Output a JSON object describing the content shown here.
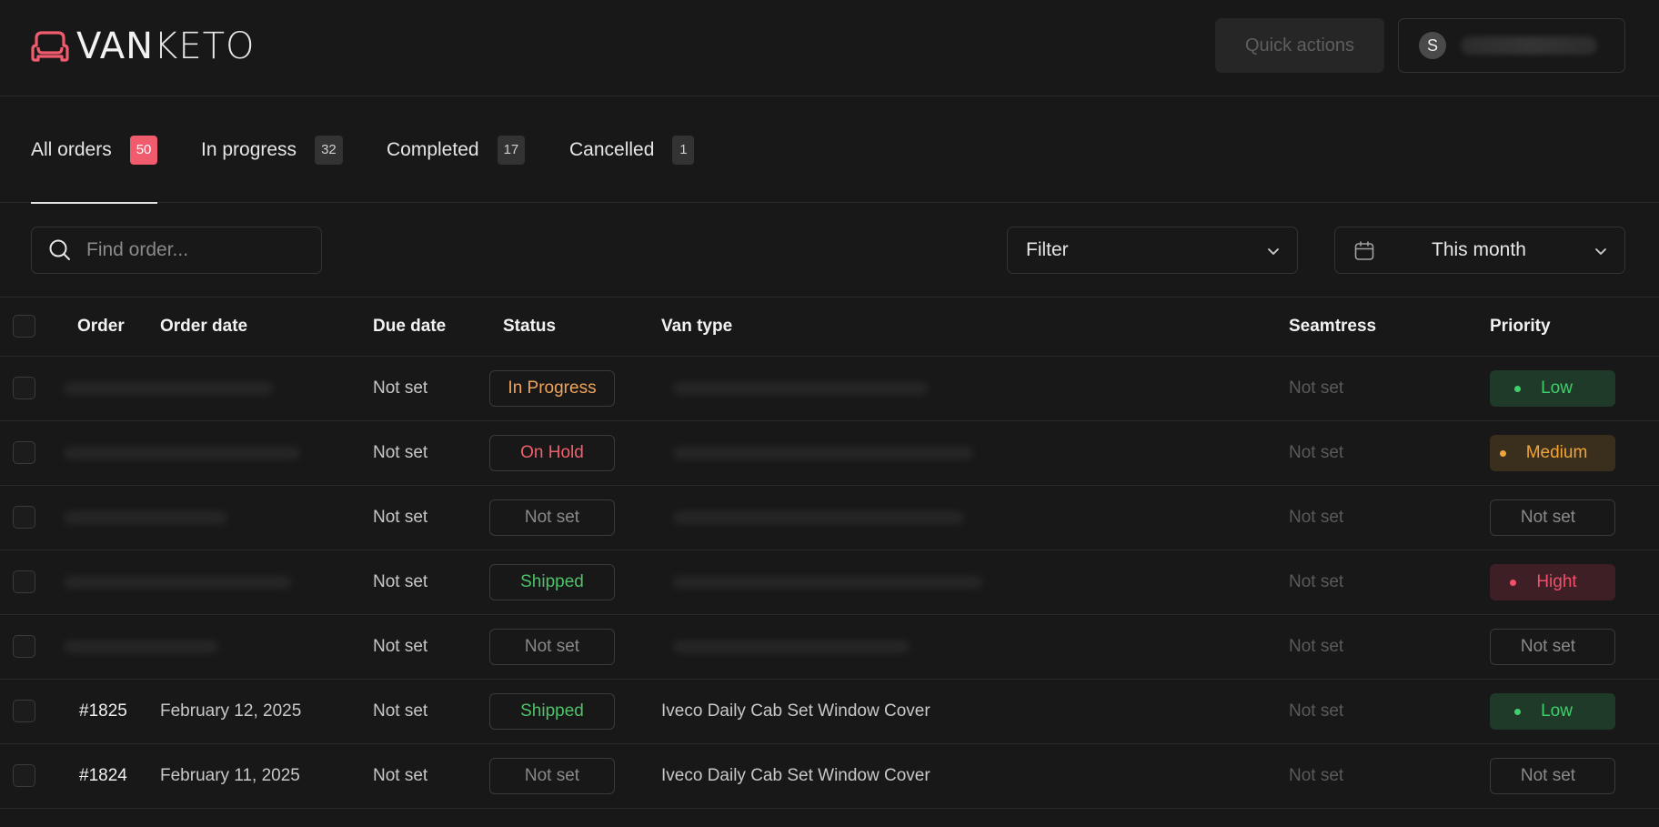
{
  "header": {
    "brand_bold": "VAN",
    "brand_thin": "KETO",
    "quick_actions_label": "Quick actions",
    "user_initial": "S"
  },
  "tabs": [
    {
      "label": "All orders",
      "count": "50",
      "active": true
    },
    {
      "label": "In progress",
      "count": "32",
      "active": false
    },
    {
      "label": "Completed",
      "count": "17",
      "active": false
    },
    {
      "label": "Cancelled",
      "count": "1",
      "active": false
    }
  ],
  "toolbar": {
    "search_placeholder": "Find order...",
    "filter_label": "Filter",
    "date_range_label": "This month"
  },
  "table": {
    "columns": [
      "Order",
      "Order date",
      "Due date",
      "Status",
      "Van type",
      "Seamtress",
      "Priority"
    ],
    "rows": [
      {
        "order": "",
        "order_date": "",
        "due_date": "Not set",
        "status": "In Progress",
        "van_type": "",
        "seamtress": "Not set",
        "priority": "Low"
      },
      {
        "order": "",
        "order_date": "",
        "due_date": "Not set",
        "status": "On Hold",
        "van_type": "",
        "seamtress": "Not set",
        "priority": "Medium"
      },
      {
        "order": "",
        "order_date": "",
        "due_date": "Not set",
        "status": "Not set",
        "van_type": "",
        "seamtress": "Not set",
        "priority": "Not set"
      },
      {
        "order": "",
        "order_date": "",
        "due_date": "Not set",
        "status": "Shipped",
        "van_type": "",
        "seamtress": "Not set",
        "priority": "Hight"
      },
      {
        "order": "",
        "order_date": "",
        "due_date": "Not set",
        "status": "Not set",
        "van_type": "",
        "seamtress": "Not set",
        "priority": "Not set"
      },
      {
        "order": "#1825",
        "order_date": "February 12, 2025",
        "due_date": "Not set",
        "status": "Shipped",
        "van_type": "Iveco Daily Cab Set Window Cover",
        "seamtress": "Not set",
        "priority": "Low"
      },
      {
        "order": "#1824",
        "order_date": "February 11, 2025",
        "due_date": "Not set",
        "status": "Not set",
        "van_type": "Iveco Daily Cab Set Window Cover",
        "seamtress": "Not set",
        "priority": "Not set"
      }
    ]
  },
  "colors": {
    "in_progress": "#f0a45a",
    "on_hold": "#f0606c",
    "shipped": "#4fc16a",
    "low_bg": "#1f3a29",
    "low_fg": "#3fcf6b",
    "medium_bg": "#3a2f1c",
    "medium_fg": "#f0a43a",
    "high_bg": "#3e1f26",
    "high_fg": "#f0506a",
    "badge_hot": "#f05b6e"
  }
}
